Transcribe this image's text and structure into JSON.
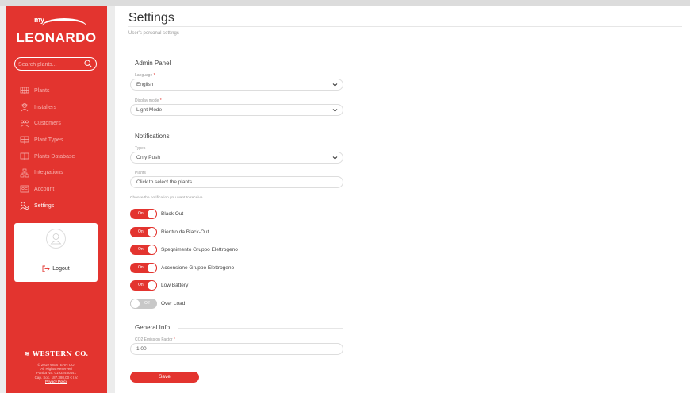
{
  "sidebar": {
    "logo_my": "my",
    "logo_text": "LEONARDO",
    "search_placeholder": "Search plants...",
    "items": [
      {
        "label": "Plants",
        "icon": "solar-panel-icon"
      },
      {
        "label": "Installers",
        "icon": "installer-icon"
      },
      {
        "label": "Customers",
        "icon": "customers-icon"
      },
      {
        "label": "Plant Types",
        "icon": "solar-panel-icon"
      },
      {
        "label": "Plants Database",
        "icon": "solar-panel-icon"
      },
      {
        "label": "Integrations",
        "icon": "integrations-icon"
      },
      {
        "label": "Account",
        "icon": "account-icon"
      },
      {
        "label": "Settings",
        "icon": "settings-icon",
        "active": true
      }
    ],
    "logout_label": "Logout",
    "brand": "WESTERN CO.",
    "footer": {
      "line1": "© 2019 WESTERN CO.",
      "line2": "All Rights Reserved",
      "line3": "Partita iva: 01932450441",
      "line4": "Cap. Soc. 187.398,00 € I.V.",
      "privacy": "Privacy Policy"
    }
  },
  "main": {
    "title": "Settings",
    "subtitle": "User's personal settings",
    "admin_panel": {
      "title": "Admin Panel",
      "language_label": "Language",
      "language_value": "English",
      "display_label": "Display mode",
      "display_value": "Light Mode"
    },
    "notifications": {
      "title": "Notifications",
      "types_label": "Types",
      "types_value": "Only Push",
      "plants_label": "Plants",
      "plants_placeholder": "Click to select the plants...",
      "hint": "Choose the notification you want to receive",
      "on_label": "On",
      "off_label": "Off",
      "toggles": [
        {
          "label": "Black Out",
          "state": "on"
        },
        {
          "label": "Rientro da Black-Out",
          "state": "on"
        },
        {
          "label": "Spegnimento Gruppo Elettrogeno",
          "state": "on"
        },
        {
          "label": "Accensione Gruppo Elettrogeno",
          "state": "on"
        },
        {
          "label": "Low Battery",
          "state": "on"
        },
        {
          "label": "Over Load",
          "state": "off"
        }
      ]
    },
    "general_info": {
      "title": "General Info",
      "co2_label": "CO2 Emission Factor",
      "co2_value": "1,00"
    },
    "save_label": "Save"
  },
  "colors": {
    "accent": "#e3342f",
    "toggle_off": "#c8c8c8"
  }
}
